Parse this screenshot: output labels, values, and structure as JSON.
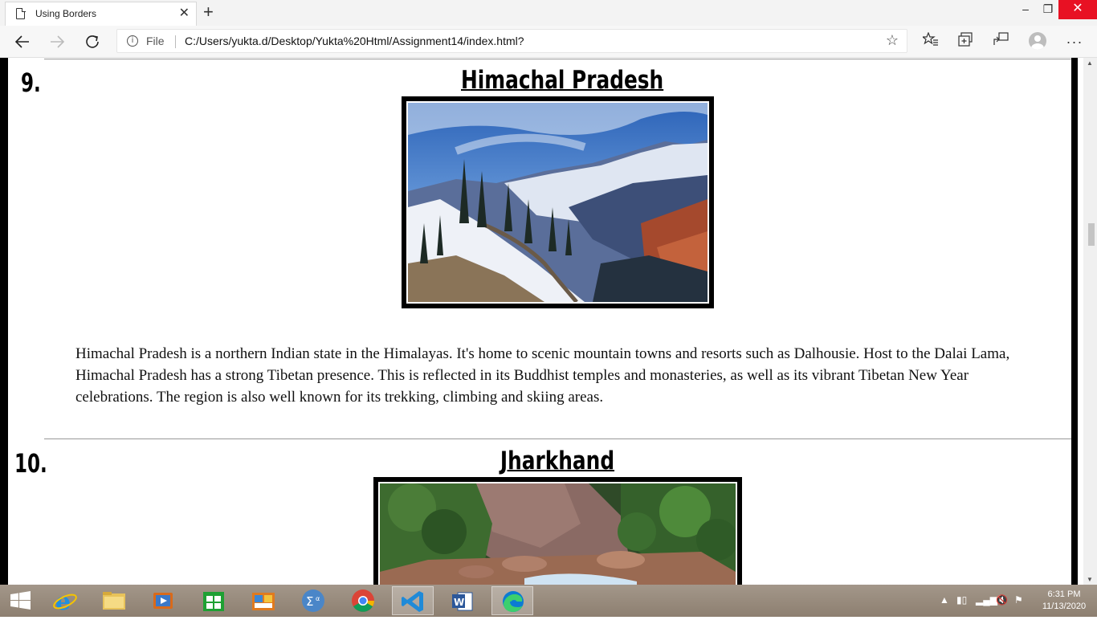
{
  "browser": {
    "tab_title": "Using Borders",
    "tab_close": "✕",
    "new_tab": "+",
    "file_label": "File",
    "url": "C:/Users/yukta.d/Desktop/Yukta%20Html/Assignment14/index.html?",
    "window_controls": {
      "minimize": "–",
      "maximize": "❐",
      "close": "✕"
    }
  },
  "page": {
    "sections": [
      {
        "number": "9.",
        "title": "Himachal Pradesh",
        "description": "Himachal Pradesh is a northern Indian state in the Himalayas. It's home to scenic mountain towns and resorts such as Dalhousie. Host to the Dalai Lama, Himachal Pradesh has a strong Tibetan presence. This is reflected in its Buddhist temples and monasteries, as well as its vibrant Tibetan New Year celebrations. The region is also well known for its trekking, climbing and skiing areas."
      },
      {
        "number": "10.",
        "title": "Jharkhand"
      }
    ]
  },
  "taskbar": {
    "apps": [
      "start-button",
      "internet-explorer-icon",
      "file-explorer-icon",
      "media-player-icon",
      "store-icon",
      "outlook-icon",
      "calculator-icon",
      "chrome-icon",
      "vscode-icon",
      "word-icon",
      "edge-icon"
    ],
    "time": "6:31 PM",
    "date": "11/13/2020"
  },
  "colors": {
    "close_button": "#e81123",
    "page_border": "#000000",
    "taskbar": "#9b8d7d"
  }
}
